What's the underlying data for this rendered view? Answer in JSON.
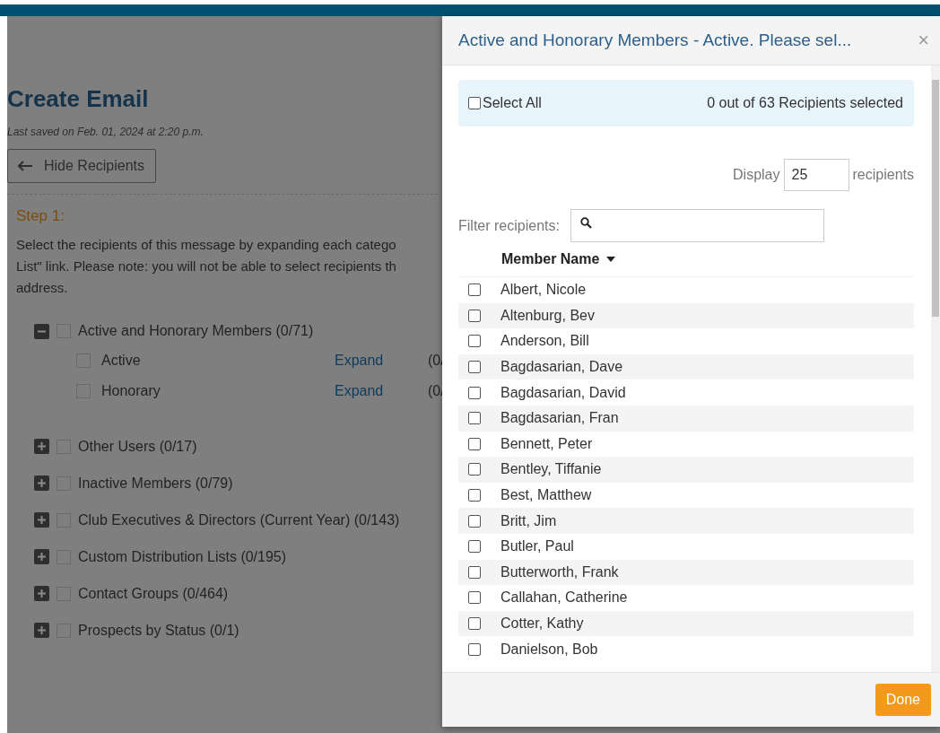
{
  "page": {
    "title": "Create Email",
    "last_saved": "Last saved on Feb. 01, 2024 at 2:20 p.m.",
    "hide_button": "Hide Recipients",
    "step_title": "Step 1:",
    "description_lines": [
      "Select the recipients of this message by expanding each catego",
      "List\" link. Please note: you will not be able to select recipients th",
      "address."
    ]
  },
  "categories": [
    {
      "label": "Active and Honorary Members (0/71)",
      "checked": false,
      "expanded": true,
      "children": [
        {
          "label": "Active",
          "checked": false,
          "link": "Expand",
          "count": "(0/"
        },
        {
          "label": "Honorary",
          "checked": false,
          "link": "Expand",
          "count": "(0/"
        }
      ]
    },
    {
      "label": "Other Users (0/17)",
      "checked": false,
      "expanded": false
    },
    {
      "label": "Inactive Members (0/79)",
      "checked": false,
      "expanded": false
    },
    {
      "label": "Club Executives & Directors (Current Year) (0/143)",
      "checked": false,
      "expanded": false
    },
    {
      "label": "Custom Distribution Lists (0/195)",
      "checked": false,
      "expanded": false
    },
    {
      "label": "Contact Groups (0/464)",
      "checked": false,
      "expanded": false
    },
    {
      "label": "Prospects by Status (0/1)",
      "checked": false,
      "expanded": false
    }
  ],
  "dialog": {
    "title": "Active and Honorary Members - Active. Please sel...",
    "close": "×",
    "select_all": {
      "label": "Select All",
      "checked": false
    },
    "selected_count": "0 out of 63 Recipients selected",
    "display_label": "Display",
    "display_value": "25",
    "display_suffix": "recipients",
    "filter_label": "Filter recipients:",
    "column": "Member Name",
    "rows": [
      {
        "name": "Albert, Nicole",
        "checked": false
      },
      {
        "name": "Altenburg, Bev",
        "checked": false
      },
      {
        "name": "Anderson, Bill",
        "checked": false
      },
      {
        "name": "Bagdasarian, Dave",
        "checked": false
      },
      {
        "name": "Bagdasarian, David",
        "checked": false
      },
      {
        "name": "Bagdasarian, Fran",
        "checked": false
      },
      {
        "name": "Bennett, Peter",
        "checked": false
      },
      {
        "name": "Bentley, Tiffanie",
        "checked": false
      },
      {
        "name": "Best, Matthew",
        "checked": false
      },
      {
        "name": "Britt, Jim",
        "checked": false
      },
      {
        "name": "Butler, Paul",
        "checked": false
      },
      {
        "name": "Butterworth, Frank",
        "checked": false
      },
      {
        "name": "Callahan, Catherine",
        "checked": false
      },
      {
        "name": "Cotter, Kathy",
        "checked": false
      },
      {
        "name": "Danielson, Bob",
        "checked": false
      }
    ],
    "done": "Done"
  }
}
